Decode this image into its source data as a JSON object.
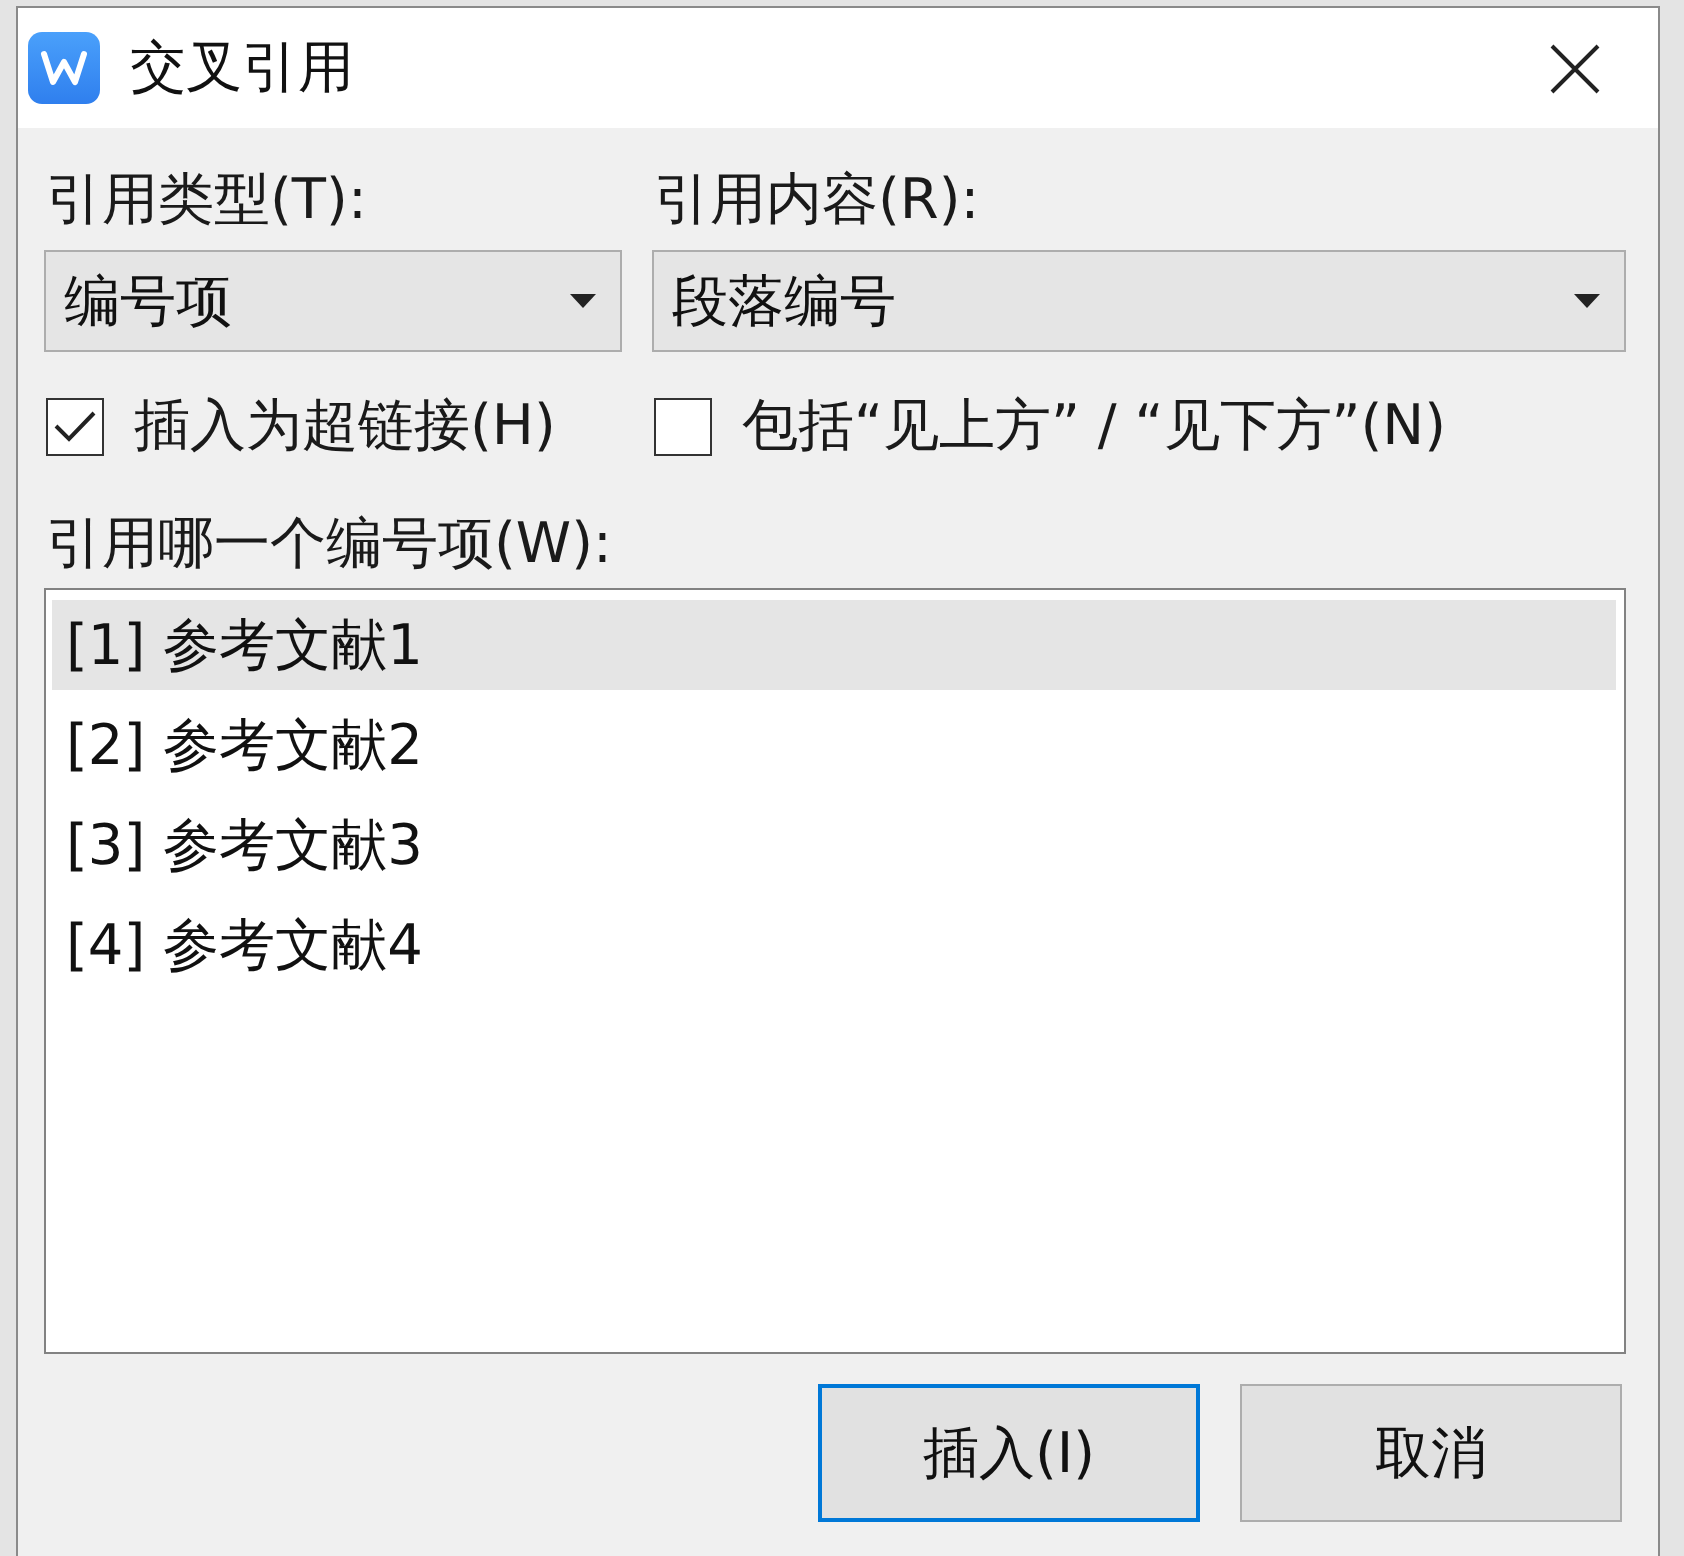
{
  "window": {
    "title": "交叉引用"
  },
  "fields": [
    {
      "label": "引用类型(T):",
      "value": "编号项"
    },
    {
      "label": "引用内容(R):",
      "value": "段落编号"
    }
  ],
  "options": [
    {
      "label": "插入为超链接(H)",
      "checked": true
    },
    {
      "label": "包括“见上方” / “见下方”(N)",
      "checked": false
    }
  ],
  "list": {
    "label": "引用哪一个编号项(W):",
    "items": [
      {
        "text": "[1] 参考文献1",
        "selected": true
      },
      {
        "text": "[2] 参考文献2",
        "selected": false
      },
      {
        "text": "[3] 参考文献3",
        "selected": false
      },
      {
        "text": "[4] 参考文献4",
        "selected": false
      }
    ]
  },
  "buttons": [
    {
      "label": "插入(I)",
      "default": true
    },
    {
      "label": "取消",
      "default": false
    }
  ]
}
